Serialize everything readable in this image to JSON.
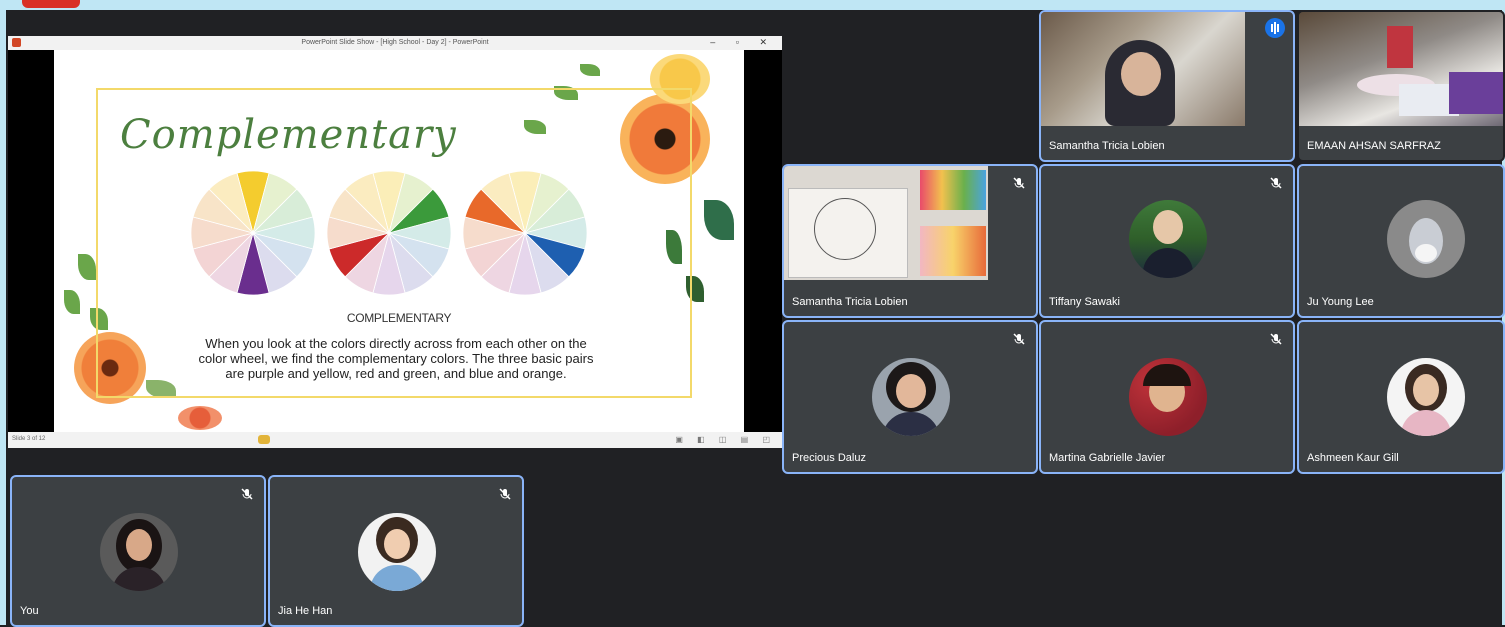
{
  "presentation": {
    "window_title": "PowerPoint Slide Show - [High School - Day 2] - PowerPoint",
    "window_controls": "–  ▫  ✕",
    "slide_heading": "Complementary",
    "slide_subheading": "COMPLEMENTARY",
    "slide_body": "When you look at the colors directly across from each other on the color wheel, we find the complementary colors. The three basic pairs are purple and yellow, red and green, and blue and orange.",
    "status_slide": "Slide 3 of 12",
    "status_icons": "▣ ◧ ◫ ▤ ◰",
    "pairs": [
      {
        "a": "#f4cc2e",
        "b": "#6a2e8e"
      },
      {
        "a": "#3b9a3b",
        "b": "#cc2a2a"
      },
      {
        "a": "#e8692a",
        "b": "#1e5fb0"
      }
    ]
  },
  "participants": {
    "p1": {
      "name": "Samantha Tricia Lobien"
    },
    "p2": {
      "name": "EMAAN AHSAN SARFRAZ"
    },
    "p3": {
      "name": "Samantha Tricia Lobien"
    },
    "p4": {
      "name": "Tiffany Sawaki"
    },
    "p5": {
      "name": "Ju Young Lee"
    },
    "p6": {
      "name": "Precious Daluz"
    },
    "p7": {
      "name": "Martina Gabrielle Javier"
    },
    "p8": {
      "name": "Ashmeen Kaur Gill"
    },
    "p9": {
      "name": "You"
    },
    "p10": {
      "name": "Jia He Han"
    }
  },
  "colors": {
    "meet_bg": "#202124",
    "tile_bg": "#3c4043",
    "highlight": "#8ab4f8",
    "speaking": "#1a73e8"
  }
}
